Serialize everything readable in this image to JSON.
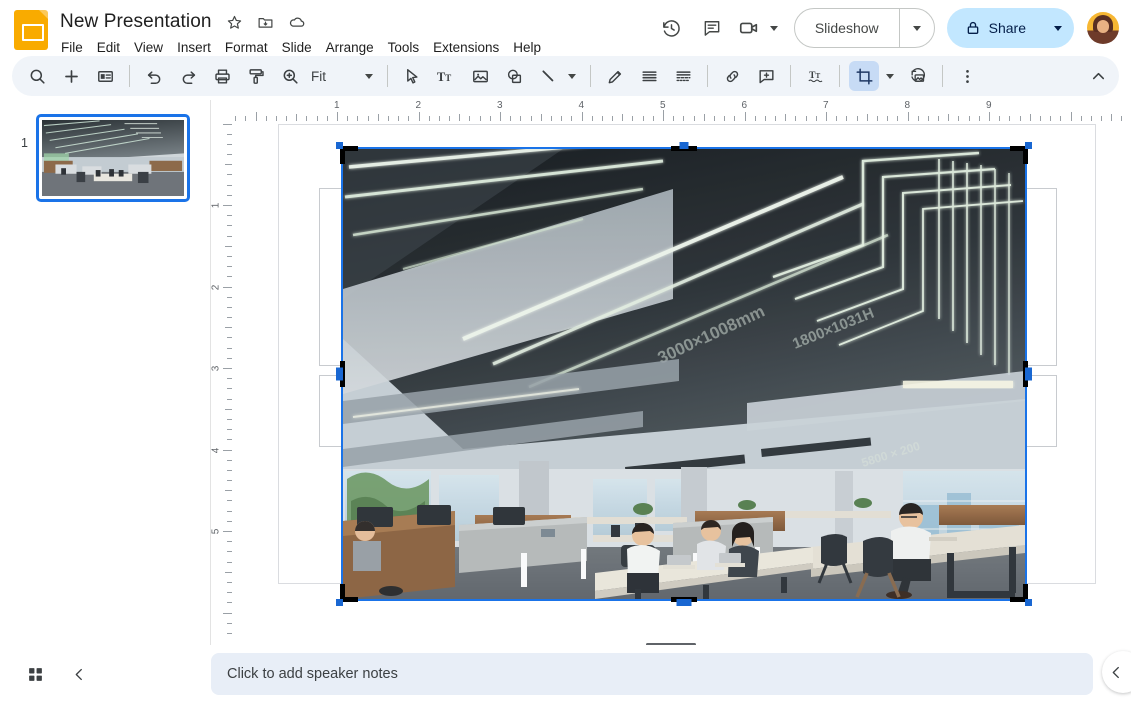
{
  "app": {
    "name": "Google Slides"
  },
  "header": {
    "logo_icon": "slides-logo-icon",
    "title": "New Presentation",
    "star_icon": "star-icon",
    "move_icon": "move-to-folder-icon",
    "cloud_icon": "cloud-saved-icon",
    "menus": [
      "File",
      "Edit",
      "View",
      "Insert",
      "Format",
      "Slide",
      "Arrange",
      "Tools",
      "Extensions",
      "Help"
    ],
    "history_icon": "version-history-icon",
    "comment_icon": "comment-icon",
    "meet_icon": "meet-camera-icon",
    "slideshow_label": "Slideshow",
    "share_label": "Share",
    "share_lock_icon": "lock-icon",
    "avatar_icon": "user-avatar"
  },
  "toolbar": {
    "items": [
      {
        "name": "search-icon",
        "label": "Search"
      },
      {
        "name": "new-slide-icon",
        "label": "New slide"
      },
      {
        "name": "layout-icon",
        "label": "Layout"
      },
      {
        "name": "undo-icon",
        "label": "Undo"
      },
      {
        "name": "redo-icon",
        "label": "Redo"
      },
      {
        "name": "print-icon",
        "label": "Print"
      },
      {
        "name": "paint-format-icon",
        "label": "Paint format"
      },
      {
        "name": "zoom-icon",
        "label": "Zoom"
      }
    ],
    "zoom_value": "Fit",
    "items2": [
      {
        "name": "select-cursor-icon",
        "label": "Select"
      },
      {
        "name": "text-box-icon",
        "label": "Text box"
      },
      {
        "name": "insert-image-icon",
        "label": "Image"
      },
      {
        "name": "shape-icon",
        "label": "Shape"
      },
      {
        "name": "line-icon",
        "label": "Line"
      },
      {
        "name": "pen-icon",
        "label": "Pen"
      },
      {
        "name": "background-icon",
        "label": "Background"
      },
      {
        "name": "transition-icon",
        "label": "Transition"
      },
      {
        "name": "insert-link-icon",
        "label": "Insert link"
      },
      {
        "name": "add-comment-icon",
        "label": "Add comment"
      },
      {
        "name": "text-format-icon",
        "label": "Text formatting"
      },
      {
        "name": "crop-image-icon",
        "label": "Crop image"
      },
      {
        "name": "reset-image-icon",
        "label": "Reset image"
      },
      {
        "name": "more-options-icon",
        "label": "More"
      }
    ],
    "crop_active": true,
    "collapse_icon": "chevron-up-icon",
    "active_highlight_color": "#c7dbf5"
  },
  "filmstrip": {
    "slides": [
      {
        "number": "1",
        "selected": true,
        "thumb_alt": "office-interior-photo"
      }
    ],
    "selection_color": "#1a73e8"
  },
  "rulers": {
    "horizontal_ticks": [
      "1",
      "2",
      "3",
      "4",
      "5",
      "6",
      "7",
      "8",
      "9"
    ],
    "vertical_ticks": [
      "1",
      "2",
      "3",
      "4",
      "5"
    ],
    "unit": "inches"
  },
  "canvas": {
    "slide_background": "#ffffff",
    "image": {
      "name": "office-interior-photo",
      "selected": true,
      "crop_mode": true,
      "selection_color": "#1a73e8",
      "handle_color": "#000000",
      "handle_accent": "#1967d2"
    },
    "placeholders": [
      {
        "name": "title-placeholder"
      },
      {
        "name": "subtitle-placeholder"
      }
    ]
  },
  "notes": {
    "grid_icon": "grid-view-icon",
    "back_icon": "chevron-left-icon",
    "placeholder": "Click to add speaker notes",
    "collapse_icon": "chevron-left-icon",
    "field_bg": "#e8eef7"
  }
}
